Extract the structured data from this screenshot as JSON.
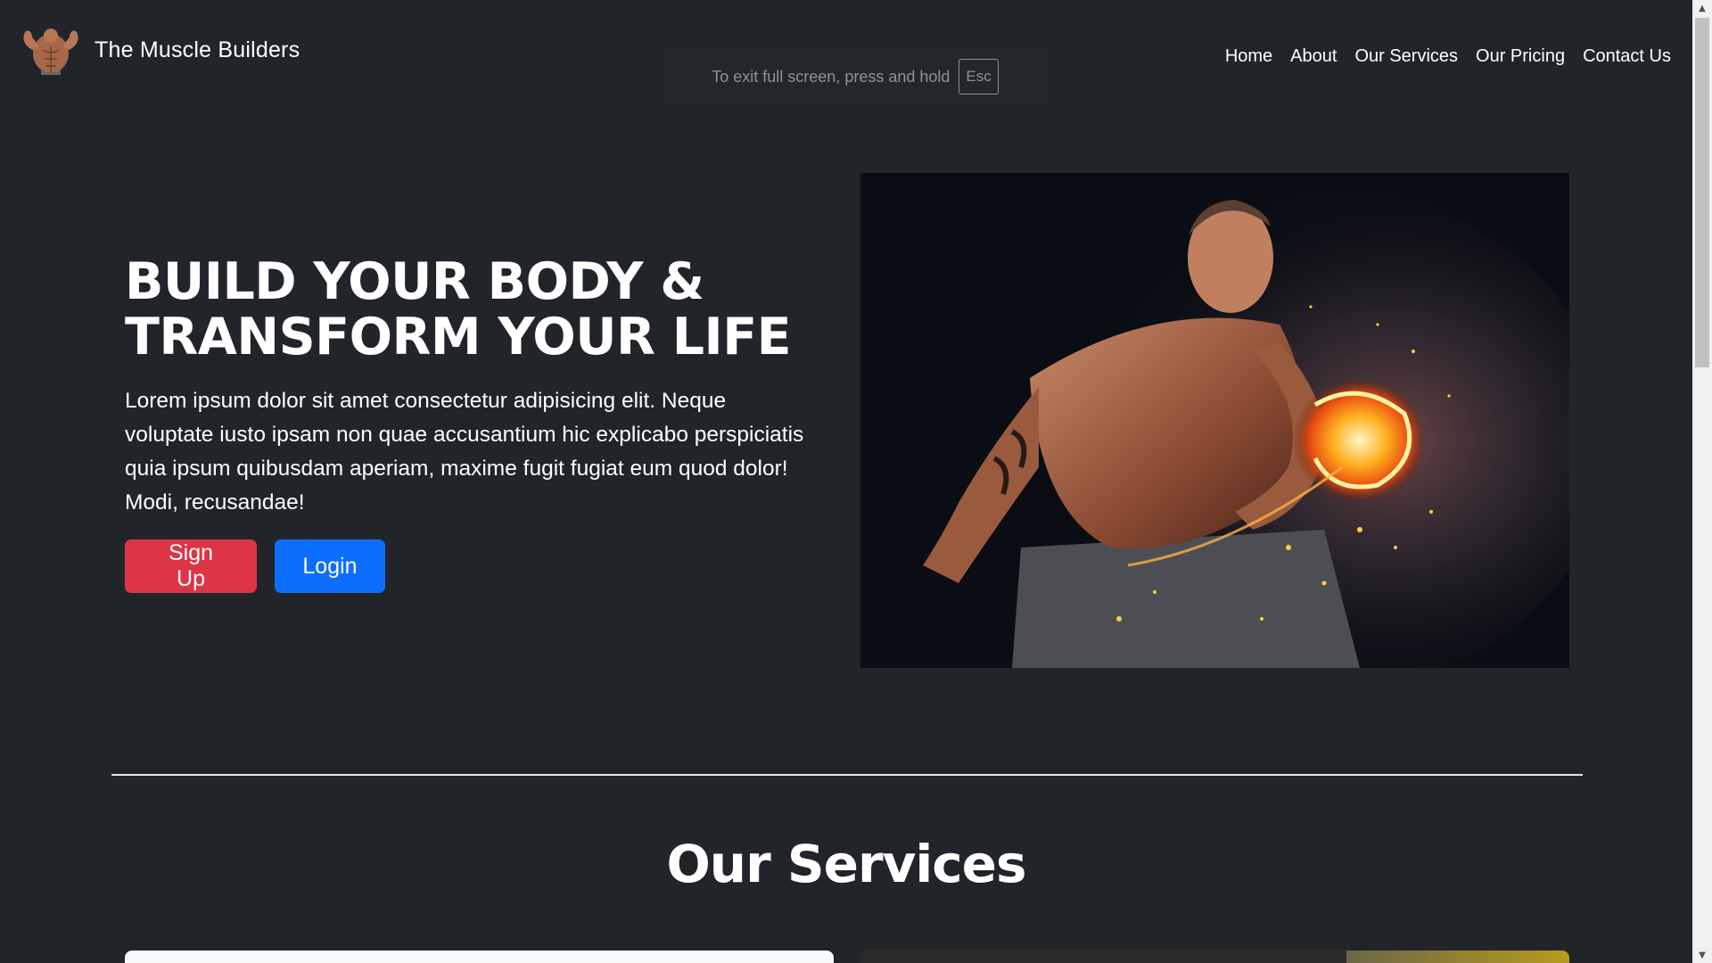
{
  "brand": {
    "name": "The Muscle Builders",
    "logo_icon": "bodybuilder-logo-icon"
  },
  "nav": {
    "items": [
      {
        "label": "Home"
      },
      {
        "label": "About"
      },
      {
        "label": "Our Services"
      },
      {
        "label": "Our Pricing"
      },
      {
        "label": "Contact Us"
      }
    ]
  },
  "fullscreen_toast": {
    "text": "To exit full screen, press and hold",
    "key": "Esc"
  },
  "hero": {
    "title_line1": "BUILD YOUR BODY &",
    "title_line2": "TRANSFORM YOUR LIFE",
    "lead": "Lorem ipsum dolor sit amet consectetur adipisicing elit. Neque voluptate iusto ipsam non quae accusantium hic explicabo perspiciatis quia ipsum quibusdam aperiam, maxime fugit fugiat eum quod dolor! Modi, recusandae!",
    "signup_label": "Sign Up",
    "login_label": "Login",
    "image_icon": "muscular-man-fire-dumbbell-image"
  },
  "services": {
    "title": "Our Services"
  },
  "colors": {
    "background": "#212529",
    "signup": "#dc3545",
    "login": "#0d6efd",
    "divider": "#dee2e6"
  }
}
